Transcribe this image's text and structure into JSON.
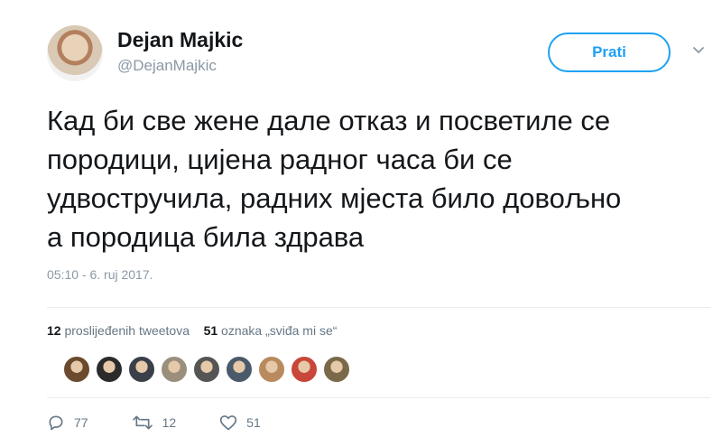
{
  "user": {
    "display_name": "Dejan Majkic",
    "handle": "@DejanMajkic",
    "avatar_icon": "profile-photo"
  },
  "follow_button": {
    "label": "Prati"
  },
  "menu_icon": "chevron-down-icon",
  "tweet": {
    "text": "Кад би све жене дале отказ и посветиле се\nпородици, цијена радног часа би се\nудвостручила, радних мјеста било довољно\nа породица била здрава",
    "timestamp": "05:10 - 6. ruj 2017."
  },
  "stats": {
    "retweets_count": "12",
    "retweets_label": "proslijeđenih tweetova",
    "likes_count": "51",
    "likes_label": "oznaka „sviđa mi se“"
  },
  "likers": [
    {
      "name": "liker-avatar-1",
      "color": "#6b4a2e"
    },
    {
      "name": "liker-avatar-2",
      "color": "#2b2b2b"
    },
    {
      "name": "liker-avatar-3",
      "color": "#3a3f4a"
    },
    {
      "name": "liker-avatar-4",
      "color": "#9a8f7d"
    },
    {
      "name": "liker-avatar-5",
      "color": "#555555"
    },
    {
      "name": "liker-avatar-6",
      "color": "#4a5a6a"
    },
    {
      "name": "liker-avatar-7",
      "color": "#b88a5e"
    },
    {
      "name": "liker-avatar-8",
      "color": "#c8473a"
    },
    {
      "name": "liker-avatar-9",
      "color": "#7a6a4a"
    }
  ],
  "actions": {
    "reply_count": "77",
    "retweet_count": "12",
    "like_count": "51"
  },
  "colors": {
    "accent": "#1da1f2",
    "muted": "#8b98a5",
    "text": "#14171a"
  }
}
